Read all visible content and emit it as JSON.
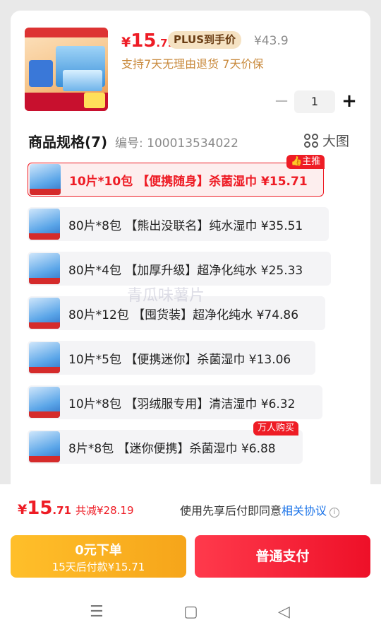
{
  "product": {
    "price_yen": "¥",
    "price_int": "15",
    "price_dec": ".71",
    "plus_label": "PLUS到手价",
    "original_price": "¥43.9",
    "guarantee": "支持7天无理由退货  7天价保",
    "quantity": "1"
  },
  "spec": {
    "title": "商品规格(7)",
    "code": "编号: 100013534022",
    "big_view_label": "大图"
  },
  "options": [
    {
      "label": "10片*10包 【便携随身】杀菌湿巾  ¥15.71",
      "selected": true,
      "badge": "主推"
    },
    {
      "label": "80片*8包 【熊出没联名】纯水湿巾  ¥35.51",
      "selected": false
    },
    {
      "label": "80片*4包 【加厚升级】超净化纯水  ¥25.33",
      "selected": false
    },
    {
      "label": "80片*12包 【囤货装】超净化纯水  ¥74.86",
      "selected": false
    },
    {
      "label": "10片*5包 【便携迷你】杀菌湿巾  ¥13.06",
      "selected": false
    },
    {
      "label": "10片*8包 【羽绒服专用】清洁湿巾  ¥6.32",
      "selected": false
    },
    {
      "label": "8片*8包 【迷你便携】杀菌湿巾  ¥6.88",
      "selected": false,
      "badge": "万人购买"
    }
  ],
  "watermark": "青瓜味薯片",
  "footer": {
    "total_yen": "¥",
    "total_int": "15",
    "total_dec": ".71",
    "reduction": "共减¥28.19",
    "agree_text": "使用先享后付即同意",
    "agree_link": "相关协议",
    "later_l1": "0元下单",
    "later_l2": "15天后付款¥15.71",
    "pay_label": "普通支付"
  },
  "nav": {
    "menu": "☰",
    "home": "▢",
    "back": "◁"
  },
  "colors": {
    "accent": "#ee1c25",
    "gold": "#f6a51a"
  }
}
